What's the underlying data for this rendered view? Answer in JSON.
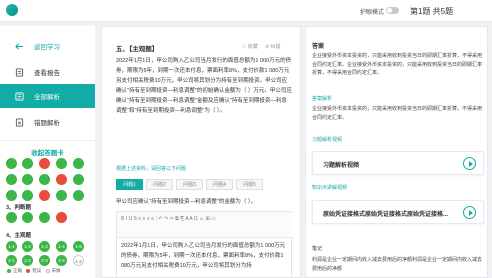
{
  "header": {
    "eye_mode_label": "护眼模式",
    "question_progress": "第1题 共5题"
  },
  "sidebar": {
    "items": [
      {
        "label": "返回学习"
      },
      {
        "label": "查看报告"
      },
      {
        "label": "全部解析"
      },
      {
        "label": "错题解析"
      }
    ]
  },
  "answer_card": {
    "title": "收起答题卡",
    "section_3": "3、判断题",
    "section_4": "4、主观题",
    "row1": [
      "",
      "",
      "",
      "",
      ""
    ],
    "row2": [
      "",
      "",
      "",
      "",
      ""
    ],
    "row3": [
      "",
      "",
      "",
      "",
      ""
    ],
    "row4": [
      "",
      "",
      "",
      ""
    ],
    "row5": [
      "1-1",
      "1-2",
      "1-3",
      "1-4",
      "1-5"
    ],
    "row6": [
      "2-1",
      "2-2",
      "2-3",
      "2-4",
      "1-2"
    ],
    "legend": {
      "correct": "正确",
      "wrong": "错误",
      "undone": "未做"
    }
  },
  "question": {
    "title": "五、【主观题】",
    "collect_label": "收藏",
    "error_label": "纠错",
    "body": "2022年1月1日，甲公司购入乙公司当月发行的面值总额为1 000万元的债券，期限为5年，到期一次还本付息，票面利率8%，支付价款1 080万元另支付相关税费10万元，甲公司将其划分为持有至到期投资。甲公司应确认\"持有至到期投资—利息调整\"的初始确认金额为（ ）万元。甲公司应确认\"持有至到期投资—利息调整\"金额及应确认\"持有至到期投资—利息调整\"和\"持有至到期投资—利息调整\"为（ ）。",
    "hint": "根据上述资料，请回答以下问题",
    "tabs": [
      "问题1",
      "问题2",
      "问题3",
      "问题4",
      "问题5"
    ],
    "sub_question": "甲公司应确认\"持有至到期投资—利息调整\"的金额为（ ）。",
    "editor_toolbar": "B  I  U  S  ≡  ≡  ≡  ≡  ⁝  ↶  ↷  ✂  ⧉  ⎘  A  A  Ω  ☺  ⊞  ▭",
    "answer_text": "2022年1月1日，甲公司购入乙公司当月发行的面值总额为1 000万元的债券，期限为5年，到期一次还本付息，票面利率8%，支付价款1 080万元另支付相关税费10万元，甲公司将其划分为持"
  },
  "analysis": {
    "answer_heading": "答案",
    "answer_text": "企业接受外币资本投资的，只能采用收到投资当日的即期汇率折算，不得采用合同约定汇率。企业接受外币资本投资的，只能采用收到投资当日的即期汇率折算，不得采用合同约定汇率。",
    "analysis_label": "答案解析",
    "analysis_text": "企业接受外币资本投资的，只能采用收到投资当日的即期汇率折算，不得采用合同约定汇率。",
    "video_label": "习题解析视频",
    "video_title": "习题解析视频",
    "kp_label": "知识点讲解视频",
    "kp_title": "原始凭证接格式原始凭证接格式原始凭证接格...",
    "note_label": "笔记",
    "note_text": "利润是企业一定期间内收入减去费用后的净额利润是企业一定期间内收入减去费用后的净额"
  },
  "colors": {
    "accent": "#13aba5",
    "correct": "#3cb549",
    "wrong": "#e84c3d"
  }
}
